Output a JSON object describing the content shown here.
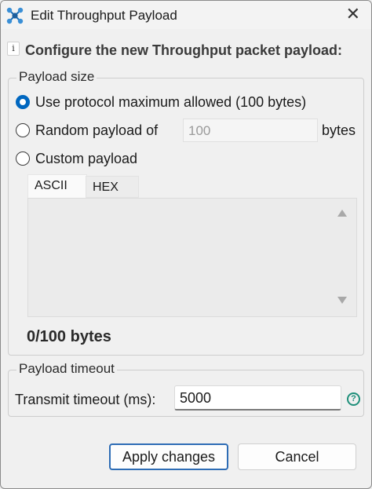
{
  "window": {
    "title": "Edit Throughput Payload",
    "close_glyph": "✕",
    "icon": "network-nodes-icon"
  },
  "info": {
    "icon_glyph": "i",
    "text": "Configure the new Throughput packet payload:"
  },
  "payload_size": {
    "legend": "Payload size",
    "options": [
      {
        "label": "Use protocol maximum allowed (100 bytes)",
        "checked": true
      },
      {
        "label": "Random payload of",
        "checked": false
      },
      {
        "label": "Custom payload",
        "checked": false
      }
    ],
    "random_value": "100",
    "random_unit": "bytes",
    "tabs": [
      "ASCII",
      "HEX"
    ],
    "active_tab": "ASCII",
    "custom_text": "",
    "counter": "0/100 bytes"
  },
  "payload_timeout": {
    "legend": "Payload timeout",
    "label": "Transmit timeout (ms):",
    "value": "5000",
    "help_glyph": "?"
  },
  "buttons": {
    "apply": "Apply changes",
    "cancel": "Cancel"
  },
  "colors": {
    "accent": "#0067c0",
    "help": "#1f8f7a",
    "primary_border": "#2d6cb5"
  }
}
